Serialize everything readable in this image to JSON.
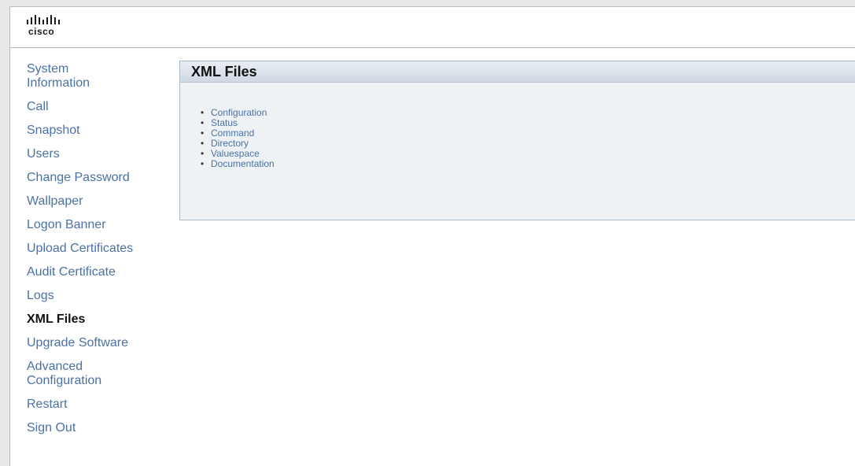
{
  "brand": {
    "name": "cisco"
  },
  "sidebar": {
    "items": [
      {
        "label": "System Information"
      },
      {
        "label": "Call"
      },
      {
        "label": "Snapshot"
      },
      {
        "label": "Users"
      },
      {
        "label": "Change Password"
      },
      {
        "label": "Wallpaper"
      },
      {
        "label": "Logon Banner"
      },
      {
        "label": "Upload Certificates"
      },
      {
        "label": "Audit Certificate"
      },
      {
        "label": "Logs"
      },
      {
        "label": "XML Files",
        "active": true
      },
      {
        "label": "Upgrade Software"
      },
      {
        "label": "Advanced Configuration"
      },
      {
        "label": "Restart"
      },
      {
        "label": "Sign Out"
      }
    ]
  },
  "main": {
    "title": "XML Files",
    "links": [
      {
        "label": "Configuration"
      },
      {
        "label": "Status"
      },
      {
        "label": "Command"
      },
      {
        "label": "Directory"
      },
      {
        "label": "Valuespace"
      },
      {
        "label": "Documentation"
      }
    ]
  },
  "colors": {
    "link": "#4b71a3",
    "active": "#111111",
    "panel_bg": "#eef2f5",
    "panel_border": "#a7b8c7"
  }
}
